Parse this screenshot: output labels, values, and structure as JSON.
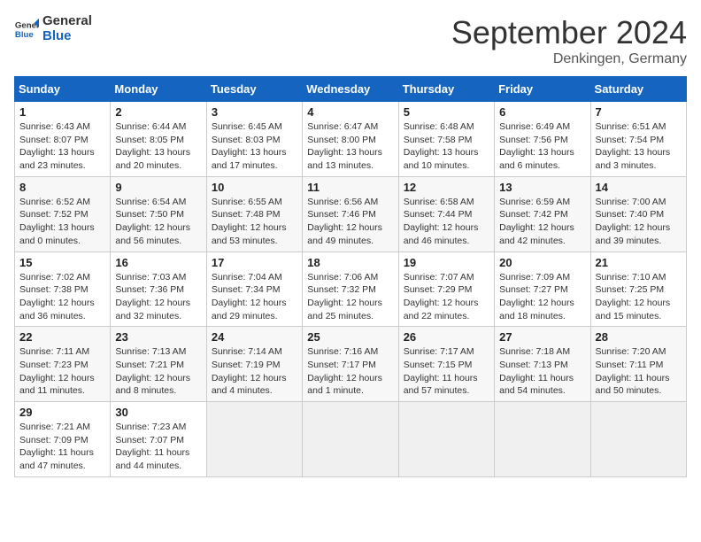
{
  "header": {
    "logo_general": "General",
    "logo_blue": "Blue",
    "month_title": "September 2024",
    "location": "Denkingen, Germany"
  },
  "columns": [
    "Sunday",
    "Monday",
    "Tuesday",
    "Wednesday",
    "Thursday",
    "Friday",
    "Saturday"
  ],
  "weeks": [
    [
      {
        "day": "1",
        "info": "Sunrise: 6:43 AM\nSunset: 8:07 PM\nDaylight: 13 hours\nand 23 minutes."
      },
      {
        "day": "2",
        "info": "Sunrise: 6:44 AM\nSunset: 8:05 PM\nDaylight: 13 hours\nand 20 minutes."
      },
      {
        "day": "3",
        "info": "Sunrise: 6:45 AM\nSunset: 8:03 PM\nDaylight: 13 hours\nand 17 minutes."
      },
      {
        "day": "4",
        "info": "Sunrise: 6:47 AM\nSunset: 8:00 PM\nDaylight: 13 hours\nand 13 minutes."
      },
      {
        "day": "5",
        "info": "Sunrise: 6:48 AM\nSunset: 7:58 PM\nDaylight: 13 hours\nand 10 minutes."
      },
      {
        "day": "6",
        "info": "Sunrise: 6:49 AM\nSunset: 7:56 PM\nDaylight: 13 hours\nand 6 minutes."
      },
      {
        "day": "7",
        "info": "Sunrise: 6:51 AM\nSunset: 7:54 PM\nDaylight: 13 hours\nand 3 minutes."
      }
    ],
    [
      {
        "day": "8",
        "info": "Sunrise: 6:52 AM\nSunset: 7:52 PM\nDaylight: 13 hours\nand 0 minutes."
      },
      {
        "day": "9",
        "info": "Sunrise: 6:54 AM\nSunset: 7:50 PM\nDaylight: 12 hours\nand 56 minutes."
      },
      {
        "day": "10",
        "info": "Sunrise: 6:55 AM\nSunset: 7:48 PM\nDaylight: 12 hours\nand 53 minutes."
      },
      {
        "day": "11",
        "info": "Sunrise: 6:56 AM\nSunset: 7:46 PM\nDaylight: 12 hours\nand 49 minutes."
      },
      {
        "day": "12",
        "info": "Sunrise: 6:58 AM\nSunset: 7:44 PM\nDaylight: 12 hours\nand 46 minutes."
      },
      {
        "day": "13",
        "info": "Sunrise: 6:59 AM\nSunset: 7:42 PM\nDaylight: 12 hours\nand 42 minutes."
      },
      {
        "day": "14",
        "info": "Sunrise: 7:00 AM\nSunset: 7:40 PM\nDaylight: 12 hours\nand 39 minutes."
      }
    ],
    [
      {
        "day": "15",
        "info": "Sunrise: 7:02 AM\nSunset: 7:38 PM\nDaylight: 12 hours\nand 36 minutes."
      },
      {
        "day": "16",
        "info": "Sunrise: 7:03 AM\nSunset: 7:36 PM\nDaylight: 12 hours\nand 32 minutes."
      },
      {
        "day": "17",
        "info": "Sunrise: 7:04 AM\nSunset: 7:34 PM\nDaylight: 12 hours\nand 29 minutes."
      },
      {
        "day": "18",
        "info": "Sunrise: 7:06 AM\nSunset: 7:32 PM\nDaylight: 12 hours\nand 25 minutes."
      },
      {
        "day": "19",
        "info": "Sunrise: 7:07 AM\nSunset: 7:29 PM\nDaylight: 12 hours\nand 22 minutes."
      },
      {
        "day": "20",
        "info": "Sunrise: 7:09 AM\nSunset: 7:27 PM\nDaylight: 12 hours\nand 18 minutes."
      },
      {
        "day": "21",
        "info": "Sunrise: 7:10 AM\nSunset: 7:25 PM\nDaylight: 12 hours\nand 15 minutes."
      }
    ],
    [
      {
        "day": "22",
        "info": "Sunrise: 7:11 AM\nSunset: 7:23 PM\nDaylight: 12 hours\nand 11 minutes."
      },
      {
        "day": "23",
        "info": "Sunrise: 7:13 AM\nSunset: 7:21 PM\nDaylight: 12 hours\nand 8 minutes."
      },
      {
        "day": "24",
        "info": "Sunrise: 7:14 AM\nSunset: 7:19 PM\nDaylight: 12 hours\nand 4 minutes."
      },
      {
        "day": "25",
        "info": "Sunrise: 7:16 AM\nSunset: 7:17 PM\nDaylight: 12 hours\nand 1 minute."
      },
      {
        "day": "26",
        "info": "Sunrise: 7:17 AM\nSunset: 7:15 PM\nDaylight: 11 hours\nand 57 minutes."
      },
      {
        "day": "27",
        "info": "Sunrise: 7:18 AM\nSunset: 7:13 PM\nDaylight: 11 hours\nand 54 minutes."
      },
      {
        "day": "28",
        "info": "Sunrise: 7:20 AM\nSunset: 7:11 PM\nDaylight: 11 hours\nand 50 minutes."
      }
    ],
    [
      {
        "day": "29",
        "info": "Sunrise: 7:21 AM\nSunset: 7:09 PM\nDaylight: 11 hours\nand 47 minutes."
      },
      {
        "day": "30",
        "info": "Sunrise: 7:23 AM\nSunset: 7:07 PM\nDaylight: 11 hours\nand 44 minutes."
      },
      {
        "day": "",
        "info": ""
      },
      {
        "day": "",
        "info": ""
      },
      {
        "day": "",
        "info": ""
      },
      {
        "day": "",
        "info": ""
      },
      {
        "day": "",
        "info": ""
      }
    ]
  ]
}
